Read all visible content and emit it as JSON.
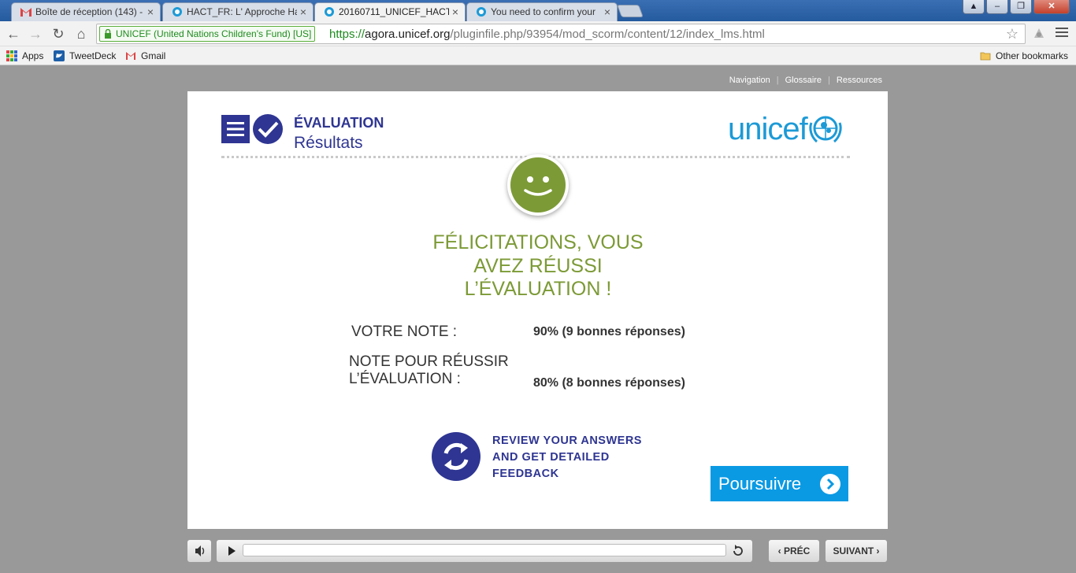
{
  "browser": {
    "tabs": [
      {
        "title": "Boîte de réception (143) -",
        "icon": "gmail-icon",
        "active": false
      },
      {
        "title": "HACT_FR: L' Approche Ha",
        "icon": "unicef-favicon",
        "active": false
      },
      {
        "title": "20160711_UNICEF_HACT_",
        "icon": "unicef-favicon",
        "active": true
      },
      {
        "title": "You need to confirm your",
        "icon": "unicef-favicon",
        "active": false
      }
    ],
    "ev_label": "UNICEF (United Nations Children's Fund) [US]",
    "url_scheme": "https://",
    "url_host": "agora.unicef.org",
    "url_path": "/pluginfile.php/93954/mod_scorm/content/12/index_lms.html",
    "bookmarks": [
      "Apps",
      "TweetDeck",
      "Gmail"
    ],
    "other_bookmarks": "Other bookmarks"
  },
  "course_nav": {
    "navigation": "Navigation",
    "separator": "|",
    "glossary": "Glossaire",
    "resources": "Ressources"
  },
  "header": {
    "title": "ÉVALUATION",
    "subtitle": "Résultats",
    "logo_text": "unicef"
  },
  "result": {
    "congrats_line1": "FÉLICITATIONS, VOUS",
    "congrats_line2": "AVEZ RÉUSSI",
    "congrats_line3": "L’ÉVALUATION !",
    "score_label": "VOTRE NOTE :",
    "score_value": "90% (9 bonnes réponses)",
    "pass_label_line1": "NOTE POUR RÉUSSIR",
    "pass_label_line2": "L’ÉVALUATION :",
    "pass_value": "80% (8 bonnes réponses)"
  },
  "review": {
    "line1": "REVIEW YOUR ANSWERS",
    "line2": "AND GET DETAILED",
    "line3": "FEEDBACK"
  },
  "continue_label": "Poursuivre",
  "player": {
    "prev_label": "PRÉC",
    "next_label": "SUIVANT",
    "progress": 0
  },
  "colors": {
    "unicef_blue": "#1c9ad6",
    "navy": "#2e3592",
    "success_green": "#7c9a36",
    "button_blue": "#0a9ae4"
  }
}
